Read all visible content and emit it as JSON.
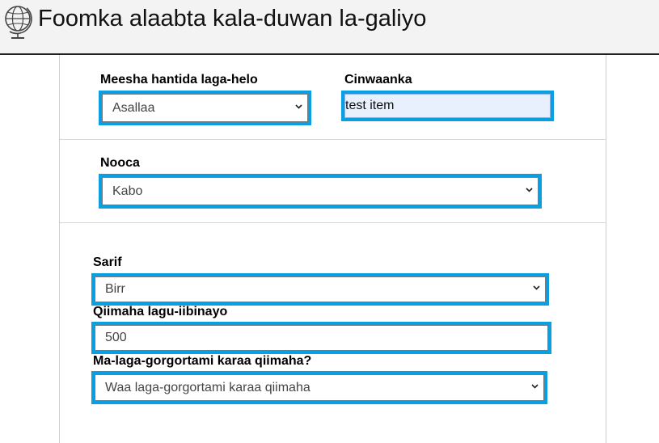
{
  "header": {
    "title": "Foomka alaabta kala-duwan la-galiyo",
    "logo_icon": "globe-icon"
  },
  "form": {
    "lost_location": {
      "label": "Meesha hantida laga-helo",
      "value": "Asallaa"
    },
    "title_field": {
      "label": "Cinwaanka",
      "value": "test item"
    },
    "type": {
      "label": "Nooca",
      "value": "Kabo"
    },
    "currency": {
      "label": "Sarif",
      "value": "Birr"
    },
    "asking_price": {
      "label": "Qiimaha lagu-iibinayo",
      "value": "500"
    },
    "negotiable": {
      "label": "Ma-laga-gorgortami karaa qiimaha?",
      "value": "Waa laga-gorgortami karaa qiimaha"
    }
  },
  "colors": {
    "focus_outline": "#0a9fe0",
    "autofill_bg": "#e8f0fe",
    "header_bg": "#f3f3f3"
  }
}
